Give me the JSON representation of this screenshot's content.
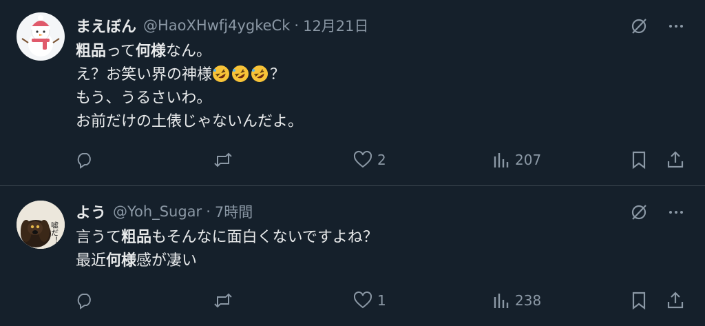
{
  "tweets": [
    {
      "name": "まえぼん",
      "handle": "@HaoXHwfj4ygkeCk",
      "separator": "·",
      "time": "12月21日",
      "lines": [
        {
          "parts": [
            {
              "t": "粗品",
              "b": true
            },
            {
              "t": "って",
              "b": false
            },
            {
              "t": "何様",
              "b": true
            },
            {
              "t": "なん。",
              "b": false
            }
          ]
        },
        {
          "parts": [
            {
              "t": "え？お笑い界の神様",
              "b": false
            }
          ],
          "emoji_count": 3,
          "emoji_name": "rolling-on-floor-laughing",
          "after": "？"
        },
        {
          "parts": [
            {
              "t": "もう、うるさいわ。",
              "b": false
            }
          ]
        },
        {
          "parts": [
            {
              "t": "お前だけの土俵じゃないんだよ。",
              "b": false
            }
          ]
        }
      ],
      "likes": "2",
      "views": "207",
      "replies": "",
      "retweets": ""
    },
    {
      "name": "よう",
      "handle": "@Yoh_Sugar",
      "separator": "·",
      "time": "7時間",
      "avatar_text": "嘘だ！",
      "lines": [
        {
          "parts": [
            {
              "t": "言うて",
              "b": false
            },
            {
              "t": "粗品",
              "b": true
            },
            {
              "t": "もそんなに面白くないですよね？",
              "b": false
            }
          ]
        },
        {
          "parts": [
            {
              "t": "最近",
              "b": false
            },
            {
              "t": "何様",
              "b": true
            },
            {
              "t": "感が凄い",
              "b": false
            }
          ]
        }
      ],
      "likes": "1",
      "views": "238",
      "replies": "",
      "retweets": ""
    }
  ],
  "icons": [
    "reply-icon",
    "retweet-icon",
    "like-icon",
    "views-icon",
    "bookmark-icon",
    "share-icon",
    "grok-icon",
    "more-icon"
  ],
  "colors": {
    "background": "#15202b",
    "text": "#e7e9ea",
    "muted": "#8b98a5",
    "divider": "#38444d"
  }
}
